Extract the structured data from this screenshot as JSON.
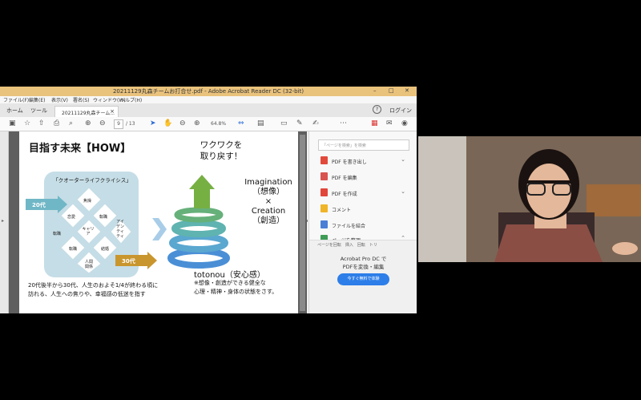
{
  "window": {
    "title": "20211129丸森チームお打合せ.pdf - Adobe Acrobat Reader DC (32-bit)",
    "controls": [
      "–",
      "□",
      "✕"
    ]
  },
  "menu": [
    "ファイル(F)",
    "編集(E)",
    "表示(V)",
    "署名(S)",
    "ウィンドウ(W)",
    "ヘルプ(H)"
  ],
  "tabs": {
    "home": "ホーム",
    "tools": "ツール",
    "document": "20211129丸森チーム...",
    "document_close": "×",
    "help": "?",
    "login": "ログイン"
  },
  "toolbar": {
    "page_current": "9",
    "page_total": "/ 13",
    "zoom": "64.8%"
  },
  "slide": {
    "title": "目指す未来【HOW】",
    "quarter_title": "「クオーターライフクライシス」",
    "keywords": [
      "焦燥",
      "転職",
      "恋愛",
      "キャリア",
      "アイデンティティ",
      "転職",
      "転職",
      "結婚",
      "人間関係"
    ],
    "arrow_left": "20代",
    "arrow_right": "30代",
    "caption_line1": "20代後半から30代、人生のおよそ1/4が終わる頃に",
    "caption_line2": "訪れる、人生への焦りや、幸福感の低迷を指す",
    "waku_line1": "ワクワクを",
    "waku_line2": "取り戻す！",
    "imagination": "Imagination",
    "imagination_jp": "（想像）",
    "times": "×",
    "creation": "Creation",
    "creation_jp": "（創造）",
    "totonou": "totonou（安心感）",
    "note_line1": "※想像・創造ができる健全な",
    "note_line2": "心理・精神・身体の状態をさす。"
  },
  "right_pane": {
    "search_placeholder": "「ページを検索」を検索",
    "tools": [
      {
        "label": "PDF を書き出し",
        "color": "#e14a3b",
        "chevron": "⌄"
      },
      {
        "label": "PDF を編集",
        "color": "#d9534f",
        "chevron": ""
      },
      {
        "label": "PDF を作成",
        "color": "#e0463a",
        "chevron": "⌄"
      },
      {
        "label": "コメント",
        "color": "#f0b429",
        "chevron": ""
      },
      {
        "label": "ファイルを結合",
        "color": "#4a7fd6",
        "chevron": ""
      },
      {
        "label": "ページを整理",
        "color": "#3e9c56",
        "chevron": "⌃"
      }
    ],
    "sub_items": "ページを回転　挿入　回転　トリ",
    "promo_line1": "Acrobat Pro DC で",
    "promo_line2": "PDFを変換・編集",
    "promo_button": "今すぐ無料で体験"
  },
  "colors": {
    "titlebar": "#e9c27c",
    "quarter_box": "#c5dde6",
    "arrow_20": "#6fb7c6",
    "arrow_30": "#c9962e",
    "promo_button": "#2d7ee8"
  }
}
